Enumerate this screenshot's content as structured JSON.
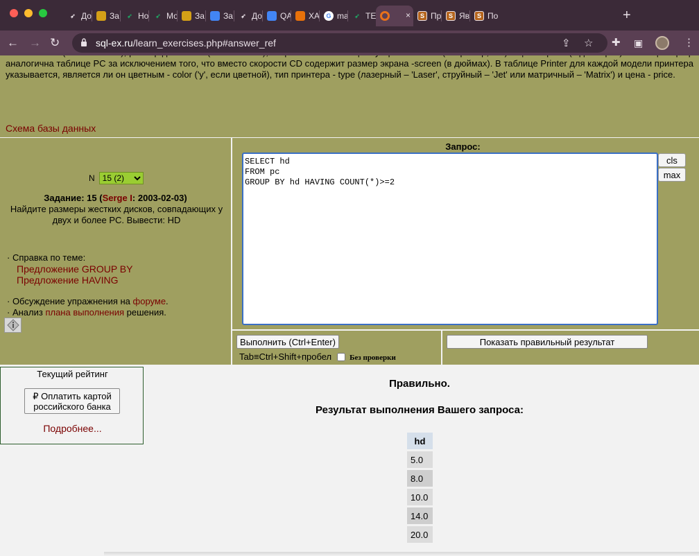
{
  "browser": {
    "tabs": [
      {
        "label": "До",
        "color": "#e8dfe6",
        "icon": "feather-icon"
      },
      {
        "label": "За",
        "color": "#d4a017",
        "icon": "classroom-icon"
      },
      {
        "label": "Но",
        "color": "#1fa463",
        "icon": "feather-icon"
      },
      {
        "label": "Мо",
        "color": "#1fa463",
        "icon": "feather-icon"
      },
      {
        "label": "За",
        "color": "#d4a017",
        "icon": "classroom-icon"
      },
      {
        "label": "За",
        "color": "#4285f4",
        "icon": "drive-icon"
      },
      {
        "label": "До",
        "color": "#e8dfe6",
        "icon": "feather-icon"
      },
      {
        "label": "QA",
        "color": "#4285f4",
        "icon": "drive-icon"
      },
      {
        "label": "ХА",
        "color": "#e8710a",
        "icon": "diamond-icon"
      },
      {
        "label": "ma",
        "color": "#ffffff",
        "icon": "google-icon"
      },
      {
        "label": "ТЕ",
        "color": "#1fa463",
        "icon": "feather-icon"
      },
      {
        "label": "",
        "color": "#e8711a",
        "icon": "target-icon",
        "active": true
      },
      {
        "label": "Пр",
        "color": "#b5651d",
        "icon": "s-icon"
      },
      {
        "label": "Яв",
        "color": "#b5651d",
        "icon": "s-icon"
      },
      {
        "label": "По",
        "color": "#b5651d",
        "icon": "s-icon"
      }
    ],
    "url_host": "sql-ex.ru",
    "url_path": "/learn_exercises.php#answer_ref"
  },
  "description": {
    "line1": "памяти - ram (в мегабайтах), размер диска - hd (в гигабайтах), скорость считывающего устройства - cd (например, '4x') и цена - price (в долларах). Таблица Laptop аналогична таблице PC за исключением того, что вместо скорости CD содержит размер экрана -screen (в дюймах). В таблице Printer для каждой модели принтера указывается, является ли он цветным - color ('y', если цветной), тип принтера - type (лазерный – 'Laser', струйный – 'Jet' или матричный – 'Matrix') и цена - price.",
    "schema_link": "Схема базы данных"
  },
  "task": {
    "n_label": "N",
    "n_selected": "15 (2)",
    "title_prefix": "Задание: 15 (",
    "author": "Serge I",
    "title_suffix": ": 2003-02-03)",
    "text": "Найдите размеры жестких дисков, совпадающих у двух и более PC. Вывести: HD",
    "help_label": "· Справка по теме:",
    "help_links": [
      "Предложение GROUP BY",
      "Предложение HAVING"
    ],
    "forum_prefix": "· Обсуждение упражнения на ",
    "forum_link": "форуме",
    "forum_suffix": ".",
    "plan_prefix": "· Анализ ",
    "plan_link": "плана выполнения",
    "plan_suffix": " решения."
  },
  "query": {
    "label": "Запрос:",
    "sql": "SELECT hd\nFROM pc\nGROUP BY hd HAVING COUNT(*)>=2",
    "cls_label": "cls",
    "max_label": "max",
    "execute_label": "Выполнить (Ctrl+Enter)",
    "tab_hint": "Tab≡Ctrl+Shift+пробел",
    "no_check_label": "Без проверки",
    "show_correct_label": "Показать правильный результат"
  },
  "rating": {
    "title": "Текущий рейтинг",
    "pay_label_1": "₽ Оплатить картой",
    "pay_label_2": "российского банка",
    "more_label": "Подробнее..."
  },
  "result": {
    "status": "Правильно.",
    "title": "Результат выполнения Вашего запроса:",
    "column": "hd",
    "rows": [
      "5.0",
      "8.0",
      "10.0",
      "14.0",
      "20.0"
    ]
  }
}
